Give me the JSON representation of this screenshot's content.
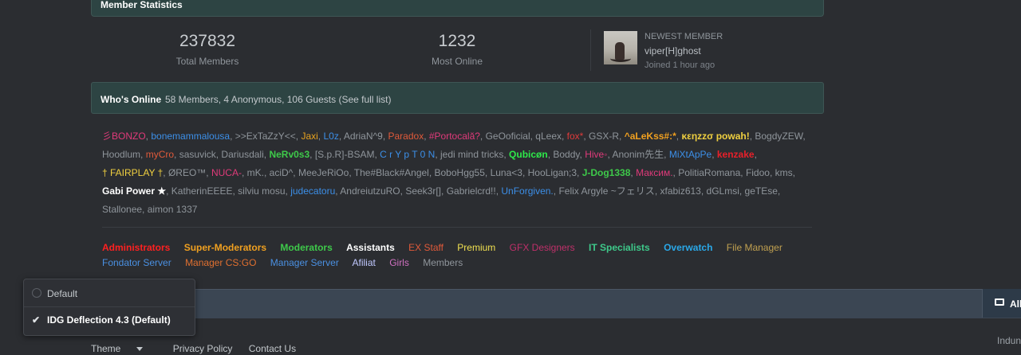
{
  "member_statistics": {
    "title": "Member Statistics"
  },
  "stats": {
    "total_members": {
      "value": "237832",
      "label": "Total Members"
    },
    "most_online": {
      "value": "1232",
      "label": "Most Online"
    }
  },
  "newest_member": {
    "heading": "NEWEST MEMBER",
    "name": "viper[H]ghost",
    "joined": "Joined 1 hour ago"
  },
  "whos_online": {
    "title": "Who's Online",
    "summary": "58 Members, 4 Anonymous, 106 Guests (See full list)"
  },
  "online_members": [
    {
      "name": "彡BONZO",
      "color": "#e03a7a"
    },
    {
      "name": "bonemammalousa",
      "color": "#3c8fe8"
    },
    {
      "name": ">>ExTaZzY<<",
      "color": "#8f959b"
    },
    {
      "name": "Jaxi",
      "color": "#e8a21e"
    },
    {
      "name": "L0z",
      "color": "#3c8fe8"
    },
    {
      "name": "AdriaN^9",
      "color": "#8f959b"
    },
    {
      "name": "Paradox",
      "color": "#e05a3a"
    },
    {
      "name": "#Portocală?",
      "color": "#e03a7a"
    },
    {
      "name": "GeOoficial",
      "color": "#8f959b"
    },
    {
      "name": "qLeex",
      "color": "#8f959b"
    },
    {
      "name": "fox*",
      "color": "#e03a3a"
    },
    {
      "name": "GSX-R",
      "color": "#8f959b"
    },
    {
      "name": "^aLeKss#:*",
      "color": "#f0a020",
      "bold": true
    },
    {
      "name": "κεηzzσ powah!",
      "color": "#f0d040",
      "bold": true
    },
    {
      "name": "BogdyZEW",
      "color": "#8f959b"
    },
    {
      "name": "Hoodlum",
      "color": "#8f959b"
    },
    {
      "name": "myCro",
      "color": "#e05a3a"
    },
    {
      "name": "sasuvick",
      "color": "#8f959b"
    },
    {
      "name": "Dariusdali",
      "color": "#8f959b"
    },
    {
      "name": "NeRv0s3",
      "color": "#3ec94a",
      "bold": true
    },
    {
      "name": "[S.p.R]-BSAM",
      "color": "#8f959b"
    },
    {
      "name": "C r Y p T 0 N",
      "color": "#3c8fe8"
    },
    {
      "name": "jedi mind tricks",
      "color": "#8f959b"
    },
    {
      "name": "Qubicøn",
      "color": "#2ee84a",
      "bold": true
    },
    {
      "name": "Boddy",
      "color": "#8f959b"
    },
    {
      "name": "Hive◦",
      "color": "#e03a7a"
    },
    {
      "name": "Anonim先生",
      "color": "#8f959b"
    },
    {
      "name": "MiXtApPe",
      "color": "#3c8fe8"
    },
    {
      "name": "kenzake",
      "color": "#e8202a",
      "bold": true
    },
    {
      "name": "† FAIRPLAY †",
      "color": "#f0d040"
    },
    {
      "name": "ØREO™",
      "color": "#8f959b"
    },
    {
      "name": "NUCA-",
      "color": "#e03a7a"
    },
    {
      "name": "mK.",
      "color": "#8f959b"
    },
    {
      "name": "aciD^",
      "color": "#8f959b"
    },
    {
      "name": "MeeJeRiOo",
      "color": "#8f959b"
    },
    {
      "name": "The#Black#Angel",
      "color": "#8f959b"
    },
    {
      "name": "BoboHgg55",
      "color": "#8f959b"
    },
    {
      "name": "Luna<3",
      "color": "#8f959b"
    },
    {
      "name": "HooLigan;3",
      "color": "#8f959b"
    },
    {
      "name": "J-Dog1338",
      "color": "#3ec94a",
      "bold": true
    },
    {
      "name": "Максим.",
      "color": "#e03a7a"
    },
    {
      "name": "PolitiaRomana",
      "color": "#8f959b"
    },
    {
      "name": "Fidoo",
      "color": "#8f959b"
    },
    {
      "name": "kms",
      "color": "#8f959b"
    },
    {
      "name": "Gabi Power ★",
      "color": "#ffffff",
      "bold": true
    },
    {
      "name": "KatherinEEEE",
      "color": "#8f959b"
    },
    {
      "name": "silviu mosu",
      "color": "#8f959b"
    },
    {
      "name": "judecatoru",
      "color": "#3c8fe8"
    },
    {
      "name": "AndreiutzuRO",
      "color": "#8f959b"
    },
    {
      "name": "Seek3r[]",
      "color": "#8f959b"
    },
    {
      "name": "Gabrielcrd!!",
      "color": "#8f959b"
    },
    {
      "name": "UnForgiven.",
      "color": "#3c8fe8"
    },
    {
      "name": "Felix Argyle ~フェリス",
      "color": "#8f959b"
    },
    {
      "name": "xfabiz613",
      "color": "#8f959b"
    },
    {
      "name": "dGLmsi",
      "color": "#8f959b"
    },
    {
      "name": "geTEse",
      "color": "#8f959b"
    },
    {
      "name": "Stallonee",
      "color": "#8f959b"
    },
    {
      "name": "aimon 1337",
      "color": "#8f959b"
    }
  ],
  "groups": [
    {
      "name": "Administrators",
      "color": "#ff2020",
      "bold": true
    },
    {
      "name": "Super-Moderators",
      "color": "#f0a020",
      "bold": true
    },
    {
      "name": "Moderators",
      "color": "#3ec94a",
      "bold": true
    },
    {
      "name": "Assistants",
      "color": "#ffffff",
      "bold": true
    },
    {
      "name": "EX Staff",
      "color": "#e05a3a"
    },
    {
      "name": "Premium",
      "color": "#f0e050"
    },
    {
      "name": "GFX Designers",
      "color": "#c0306a"
    },
    {
      "name": "IT Specialists",
      "color": "#3ec98a",
      "bold": true
    },
    {
      "name": "Overwatch",
      "color": "#2aa8e8",
      "bold": true
    },
    {
      "name": "File Manager",
      "color": "#c0a050"
    },
    {
      "name": "Fondator Server",
      "color": "#4a90e2"
    },
    {
      "name": "Manager CS:GO",
      "color": "#e07030"
    },
    {
      "name": "Manager Server",
      "color": "#4a90e2"
    },
    {
      "name": "Afiliat",
      "color": "#c0c8ff"
    },
    {
      "name": "Girls",
      "color": "#d070c0"
    },
    {
      "name": "Members",
      "color": "#8f959b"
    }
  ],
  "footer": {
    "all_button": "All",
    "theme_label": "Theme",
    "privacy_label": "Privacy Policy",
    "contact_label": "Contact Us",
    "right_text": "Indun"
  },
  "theme_menu": {
    "options": [
      {
        "label": "Default",
        "selected": false
      },
      {
        "label": "IDG Deflection 4.3 (Default)",
        "selected": true
      }
    ]
  }
}
